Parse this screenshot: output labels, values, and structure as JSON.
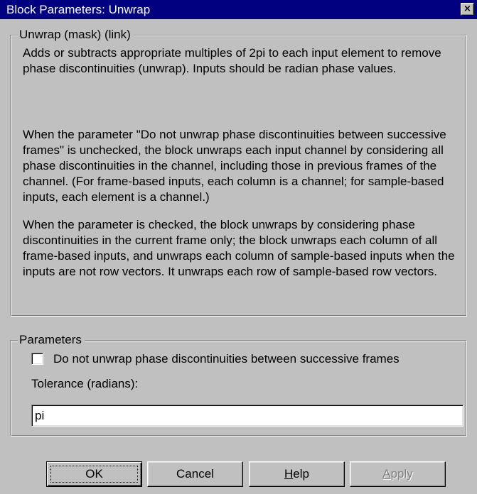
{
  "window": {
    "title": "Block Parameters: Unwrap",
    "close_glyph": "×"
  },
  "description": {
    "group_title": "Unwrap (mask) (link)",
    "paragraphs": [
      "Adds or subtracts appropriate multiples of 2pi to each input element to remove phase discontinuities (unwrap). Inputs should be radian phase values.",
      "When the parameter \"Do not unwrap phase discontinuities between successive frames\" is unchecked, the block unwraps each input channel by considering all phase discontinuities in the channel, including those in previous frames of the channel. (For frame-based inputs, each column is a channel;  for sample-based inputs, each element is a channel.)",
      "When the parameter is checked, the block unwraps by considering phase discontinuities in the current frame only; the block unwraps each column of all frame-based inputs, and unwraps each column of sample-based inputs when the inputs are not row vectors.  It unwraps each row of sample-based row vectors."
    ]
  },
  "parameters": {
    "group_title": "Parameters",
    "checkbox_label": "Do not unwrap phase discontinuities between successive frames",
    "checkbox_checked": false,
    "tolerance_label": "Tolerance (radians):",
    "tolerance_value": "pi"
  },
  "buttons": {
    "ok": "OK",
    "cancel": "Cancel",
    "help_mnemonic": "H",
    "help_rest": "elp",
    "apply_mnemonic": "A",
    "apply_rest": "pply",
    "apply_enabled": false
  },
  "colors": {
    "titlebar": "#000080",
    "face": "#c0c0c0",
    "disabled_text": "#808080"
  }
}
